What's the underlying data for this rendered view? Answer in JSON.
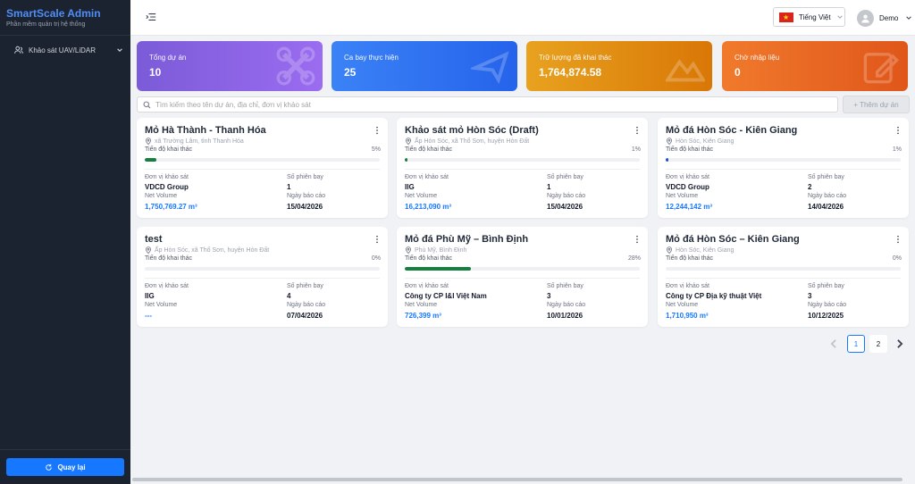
{
  "app": {
    "title": "SmartScale Admin",
    "subtitle": "Phần mềm quản trị hệ thống"
  },
  "sidebar": {
    "items": [
      {
        "label": "Khảo sát UAV/LiDAR",
        "icon": "people-icon"
      }
    ],
    "back_label": "Quay lại"
  },
  "header": {
    "language": "Tiếng Việt",
    "user": "Demo"
  },
  "stats": [
    {
      "label": "Tổng dự án",
      "value": "10",
      "color": "#8b5cf6"
    },
    {
      "label": "Ca bay thực hiện",
      "value": "25",
      "color": "#3b82f6"
    },
    {
      "label": "Trữ lượng đã khai thác",
      "value": "1,764,874.58",
      "color": "#e39b1c"
    },
    {
      "label": "Chờ nhập liệu",
      "value": "0",
      "color": "#e8621f"
    }
  ],
  "search": {
    "placeholder": "Tìm kiếm theo tên dự án, địa chỉ, đơn vị khảo sát"
  },
  "toolbar": {
    "add_label": "+ Thêm dự án"
  },
  "labels": {
    "progress": "Tiến độ khai thác",
    "unit": "Đơn vị khảo sát",
    "flights": "Số phiên bay",
    "net_volume": "Net Volume",
    "report_date": "Ngày báo cáo"
  },
  "projects": [
    {
      "title": "Mỏ Hà Thành - Thanh Hóa",
      "address": "xã Trường Lâm, tỉnh Thanh Hóa",
      "progress_pct": 5,
      "progress_label": "5%",
      "progress_color": "#15803d",
      "unit": "VDCD Group",
      "flights": "1",
      "volume": "1,750,769.27 m³",
      "date": "15/04/2026"
    },
    {
      "title": "Khảo sát mỏ Hòn Sóc (Draft)",
      "address": "Ấp Hòn Sóc, xã Thổ Sơn, huyện Hòn Đất",
      "progress_pct": 1,
      "progress_label": "1%",
      "progress_color": "#15803d",
      "unit": "IIG",
      "flights": "1",
      "volume": "16,213,090 m³",
      "date": "15/04/2026"
    },
    {
      "title": "Mỏ đá Hòn Sóc - Kiên Giang",
      "address": "Hòn Sóc, Kiên Giang",
      "progress_pct": 1,
      "progress_label": "1%",
      "progress_color": "#1d4ed8",
      "unit": "VDCD Group",
      "flights": "2",
      "volume": "12,244,142 m³",
      "date": "14/04/2026"
    },
    {
      "title": "test",
      "address": "Ấp Hòn Sóc, xã Thổ Sơn, huyện Hòn Đất",
      "progress_pct": 0,
      "progress_label": "0%",
      "progress_color": "#15803d",
      "unit": "IIG",
      "flights": "4",
      "volume": "---",
      "date": "07/04/2026"
    },
    {
      "title": "Mỏ đá Phù Mỹ – Bình Định",
      "address": "Phù Mỹ, Bình Định",
      "progress_pct": 28,
      "progress_label": "28%",
      "progress_color": "#15803d",
      "unit": "Công ty CP I&I Việt Nam",
      "flights": "3",
      "volume": "726,399 m³",
      "date": "10/01/2026"
    },
    {
      "title": "Mỏ đá Hòn Sóc – Kiên Giang",
      "address": "Hòn Sóc, Kiên Giang",
      "progress_pct": 0,
      "progress_label": "0%",
      "progress_color": "#15803d",
      "unit": "Công ty CP Địa kỹ thuật Việt",
      "flights": "3",
      "volume": "1,710,950 m³",
      "date": "10/12/2025"
    }
  ],
  "pagination": {
    "pages": [
      "1",
      "2"
    ],
    "current": "1"
  }
}
